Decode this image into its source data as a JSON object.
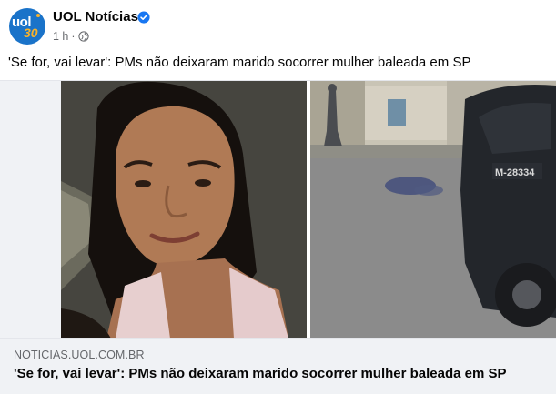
{
  "page": {
    "name": "UOL Notícias",
    "avatar_text": "uol",
    "avatar_badge": "30",
    "timestamp": "1 h",
    "separator": "·",
    "verified_icon": "verified-badge-icon",
    "audience_icon": "globe-icon"
  },
  "post": {
    "text": "'Se for, vai levar': PMs não deixaram marido socorrer mulher baleada em SP"
  },
  "media": {
    "left_photo": "woman-portrait-photo",
    "right_photo": "street-police-car-photo",
    "car_plate": "M-28334"
  },
  "link_preview": {
    "domain": "NOTICIAS.UOL.COM.BR",
    "title": "'Se for, vai levar': PMs não deixaram marido socorrer mulher baleada em SP"
  },
  "colors": {
    "brand": "#1a73c9",
    "verified": "#1877f2",
    "text_primary": "#050505",
    "text_secondary": "#65676b",
    "card_bg": "#f0f2f5"
  }
}
